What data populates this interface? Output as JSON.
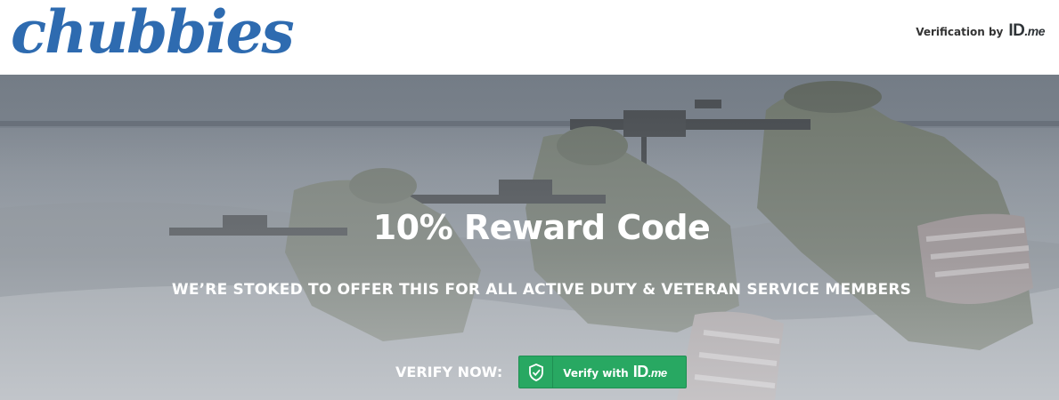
{
  "header": {
    "logo_text": "chubbies",
    "verification_label": "Verification by",
    "idme_brand_id": "ID",
    "idme_brand_me": ".me"
  },
  "hero": {
    "title": "10% Reward Code",
    "subtitle": "WE’RE STOKED TO OFFER THIS FOR ALL ACTIVE DUTY & VETERAN SERVICE MEMBERS",
    "verify_label": "VERIFY NOW:",
    "button": {
      "text": "Verify with",
      "brand_id": "ID",
      "brand_me": ".me",
      "icon": "shield-check-icon"
    }
  },
  "colors": {
    "logo": "#2e6bb0",
    "button": "#28a862",
    "hero_text": "#ffffff"
  }
}
